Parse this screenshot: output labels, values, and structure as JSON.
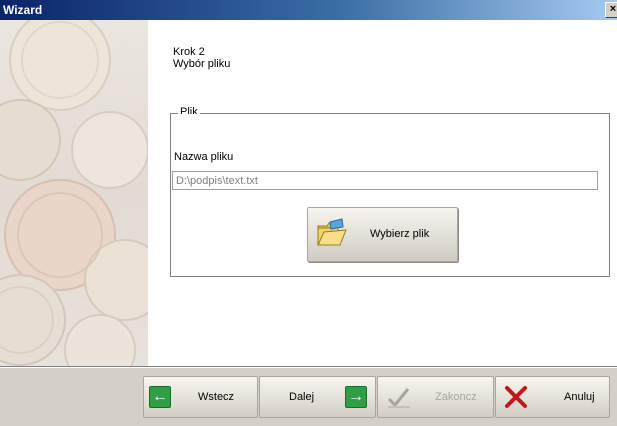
{
  "window": {
    "title": "Wizard",
    "close_glyph": "×"
  },
  "step": {
    "line1": "Krok 2",
    "line2": "Wybór pliku"
  },
  "group": {
    "legend": "Plik",
    "field_label": "Nazwa pliku",
    "file_value": "D:\\podpis\\text.txt",
    "choose_label": "Wybierz plik",
    "choose_icon": "folder-open-icon"
  },
  "buttons": {
    "back": {
      "label": "Wstecz",
      "icon": "arrow-left-icon",
      "enabled": true
    },
    "next": {
      "label": "Dalej",
      "icon": "arrow-right-icon",
      "enabled": true
    },
    "finish": {
      "label": "Zakoncz",
      "icon": "checkmark-icon",
      "enabled": false
    },
    "cancel": {
      "label": "Anuluj",
      "icon": "x-icon",
      "enabled": true
    }
  },
  "colors": {
    "title_bar": "#0a246a",
    "arrow_green": "#2f9e44",
    "cancel_red": "#c0191b"
  }
}
